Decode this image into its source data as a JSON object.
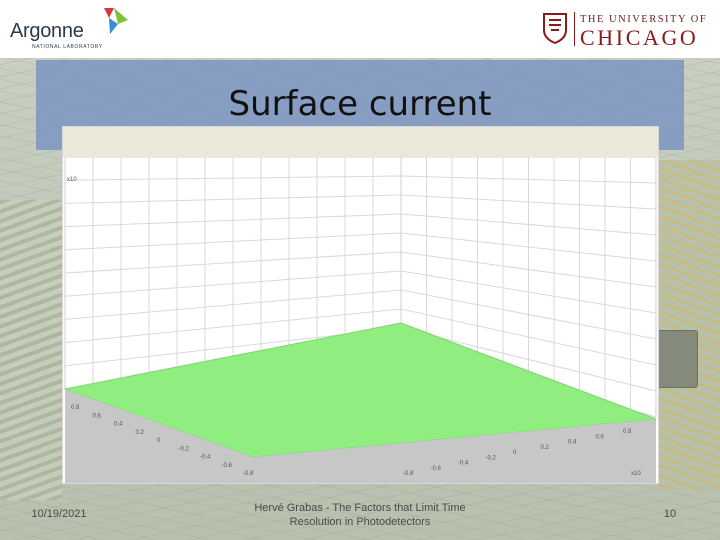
{
  "header": {
    "left_logo": {
      "wordmark": "Argonne",
      "subtitle": "NATIONAL LABORATORY",
      "colors": {
        "red": "#d63a3a",
        "green": "#7fbf3a",
        "blue": "#3a8bd6"
      }
    },
    "right_logo": {
      "line1": "THE UNIVERSITY OF",
      "line2": "CHICAGO",
      "color": "#8b1a1a"
    }
  },
  "slide": {
    "title": "Surface current",
    "title_band_color": "#7f98c2"
  },
  "plot": {
    "surface_color": "#90ee80",
    "grid_color": "#d9d9d9",
    "header_color": "#ebe7d9",
    "tick_labels_left": [
      "0.8",
      "0.6",
      "0.4",
      "0.2",
      "0",
      "-0.2",
      "-0.4",
      "-0.6",
      "-0.8"
    ],
    "tick_labels_right": [
      "0.8",
      "0.6",
      "0.4",
      "0.2",
      "0",
      "-0.2",
      "-0.4",
      "-0.6",
      "-0.8"
    ],
    "corner_label_top_left": "x10",
    "corner_label_bottom_right": "x10"
  },
  "footer": {
    "date": "10/19/2021",
    "caption": "Hervé Grabas - The Factors that Limit Time Resolution in Photodetectors",
    "page_number": "10"
  }
}
